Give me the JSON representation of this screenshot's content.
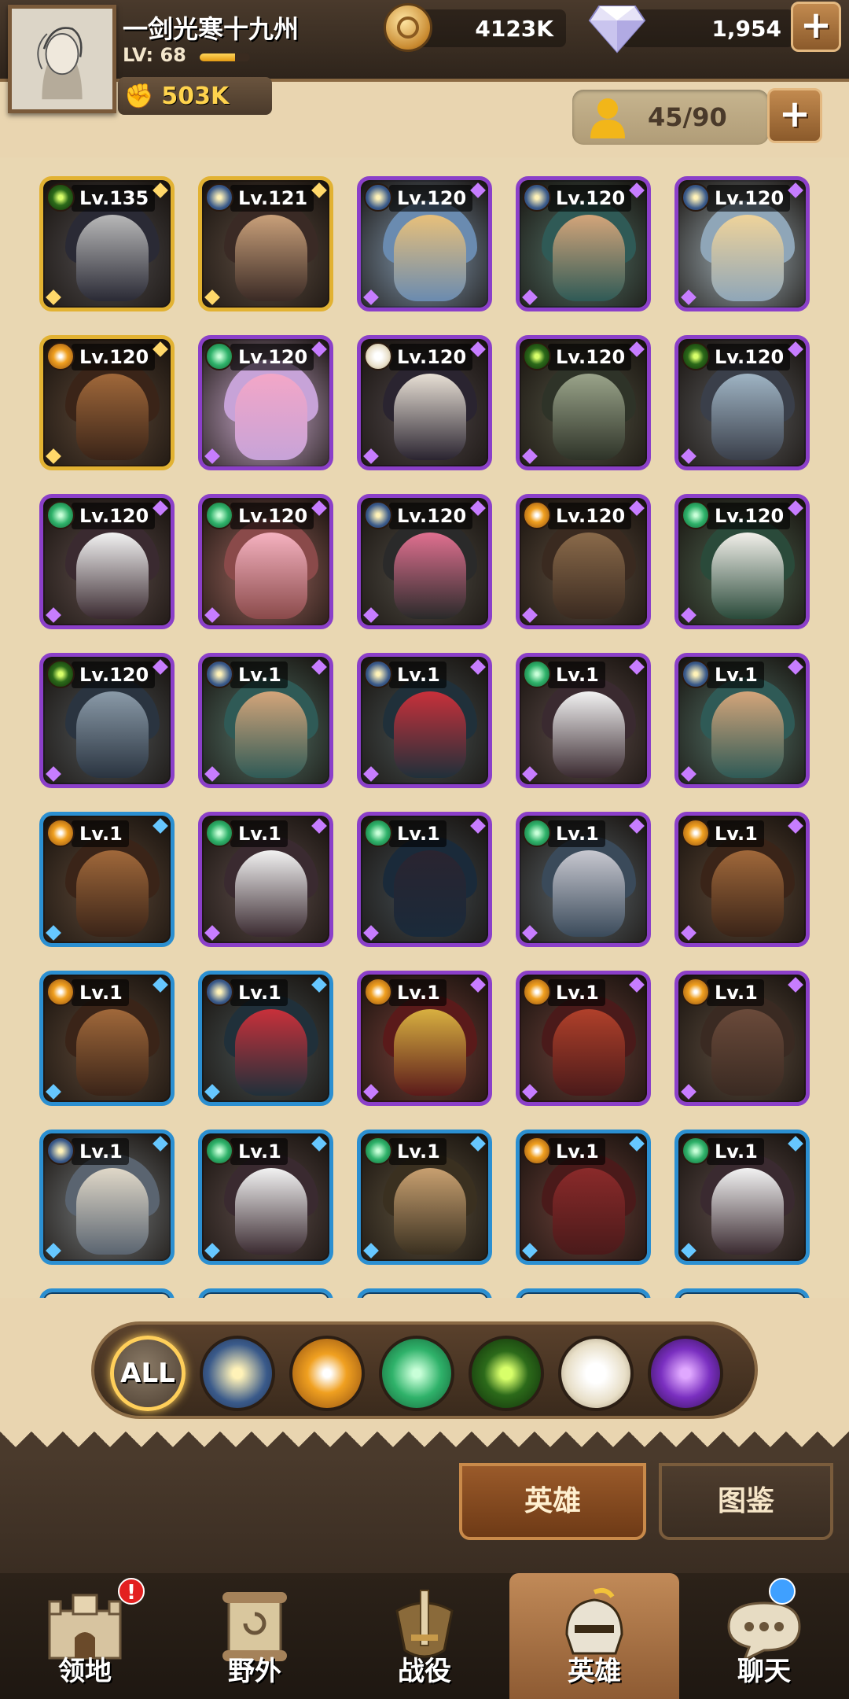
{
  "player": {
    "name": "一剑光寒十九州",
    "level_text": "LV: 68",
    "xp_fraction": 0.7,
    "power": "503K"
  },
  "resources": {
    "gold": "4123K",
    "gems": "1,954"
  },
  "hero_count": "45/90",
  "colors": {
    "purple_border": "#8b3fc9",
    "gold_border": "#e2b232",
    "blue_border": "#2b8fd1",
    "light_faction": "#f0c84a",
    "mauler_faction": "#e08a1e",
    "wilder_faction": "#2fb26a",
    "graveborn_faction": "#3f8a2c",
    "celestial_faction": "#f3efe5",
    "hypogean_faction": "#8a3fd0"
  },
  "heroes": [
    {
      "level": "Lv.135",
      "frame": "gold",
      "faction": "graveborn",
      "palette": [
        "#2a2a35",
        "#b8b8b8"
      ]
    },
    {
      "level": "Lv.121",
      "frame": "gold",
      "faction": "lightbearer",
      "palette": [
        "#3a2a25",
        "#c9a07a"
      ]
    },
    {
      "level": "Lv.120",
      "frame": "purple",
      "faction": "lightbearer",
      "palette": [
        "#6a8bb0",
        "#e8c07a"
      ]
    },
    {
      "level": "Lv.120",
      "frame": "purple",
      "faction": "lightbearer",
      "palette": [
        "#2f5a56",
        "#d4a57a"
      ]
    },
    {
      "level": "Lv.120",
      "frame": "purple",
      "faction": "lightbearer",
      "palette": [
        "#8fa6b8",
        "#efd39a"
      ]
    },
    {
      "level": "Lv.120",
      "frame": "gold",
      "faction": "mauler",
      "palette": [
        "#3a2418",
        "#a0683a"
      ]
    },
    {
      "level": "Lv.120",
      "frame": "purple",
      "faction": "wilder",
      "palette": [
        "#c7a3d8",
        "#f3a6c7"
      ]
    },
    {
      "level": "Lv.120",
      "frame": "purple",
      "faction": "celestial",
      "palette": [
        "#2a2430",
        "#e8e0d5"
      ]
    },
    {
      "level": "Lv.120",
      "frame": "purple",
      "faction": "graveborn",
      "palette": [
        "#2e3328",
        "#9aa48a"
      ]
    },
    {
      "level": "Lv.120",
      "frame": "purple",
      "faction": "graveborn",
      "palette": [
        "#3a3f4a",
        "#9fb4c4"
      ]
    },
    {
      "level": "Lv.120",
      "frame": "purple",
      "faction": "wilder",
      "palette": [
        "#3a2a30",
        "#f2f2f2"
      ]
    },
    {
      "level": "Lv.120",
      "frame": "purple",
      "faction": "wilder",
      "palette": [
        "#8a4a4a",
        "#f5b2c0"
      ]
    },
    {
      "level": "Lv.120",
      "frame": "purple",
      "faction": "lightbearer",
      "palette": [
        "#2a2a2a",
        "#e07090"
      ]
    },
    {
      "level": "Lv.120",
      "frame": "purple",
      "faction": "mauler",
      "palette": [
        "#3a2a20",
        "#8a6a4a"
      ]
    },
    {
      "level": "Lv.120",
      "frame": "purple",
      "faction": "wilder",
      "palette": [
        "#2a4a3a",
        "#f2f0ea"
      ]
    },
    {
      "level": "Lv.120",
      "frame": "purple",
      "faction": "graveborn",
      "palette": [
        "#2a3440",
        "#8a9aa8"
      ]
    },
    {
      "level": "Lv.1",
      "frame": "purple",
      "faction": "lightbearer",
      "palette": [
        "#2f5a56",
        "#d4a57a"
      ]
    },
    {
      "level": "Lv.1",
      "frame": "purple",
      "faction": "lightbearer",
      "palette": [
        "#20303a",
        "#c8303a"
      ]
    },
    {
      "level": "Lv.1",
      "frame": "purple",
      "faction": "wilder",
      "palette": [
        "#3a2a30",
        "#f2f2f2"
      ]
    },
    {
      "level": "Lv.1",
      "frame": "purple",
      "faction": "lightbearer",
      "palette": [
        "#2f5a56",
        "#d4a57a"
      ]
    },
    {
      "level": "Lv.1",
      "frame": "blue",
      "faction": "mauler",
      "palette": [
        "#3a2418",
        "#a0683a"
      ]
    },
    {
      "level": "Lv.1",
      "frame": "purple",
      "faction": "wilder",
      "palette": [
        "#3a2a30",
        "#f2f2f2"
      ]
    },
    {
      "level": "Lv.1",
      "frame": "purple",
      "faction": "wilder",
      "palette": [
        "#1a2a3a",
        "#2a2430"
      ]
    },
    {
      "level": "Lv.1",
      "frame": "purple",
      "faction": "wilder",
      "palette": [
        "#3a4a5a",
        "#c8c8d0"
      ]
    },
    {
      "level": "Lv.1",
      "frame": "purple",
      "faction": "mauler",
      "palette": [
        "#3a2418",
        "#a0683a"
      ]
    },
    {
      "level": "Lv.1",
      "frame": "blue",
      "faction": "mauler",
      "palette": [
        "#3a2418",
        "#a0683a"
      ]
    },
    {
      "level": "Lv.1",
      "frame": "blue",
      "faction": "lightbearer",
      "palette": [
        "#20303a",
        "#c8303a"
      ]
    },
    {
      "level": "Lv.1",
      "frame": "purple",
      "faction": "mauler",
      "palette": [
        "#5a1a1a",
        "#d8b040"
      ]
    },
    {
      "level": "Lv.1",
      "frame": "purple",
      "faction": "mauler",
      "palette": [
        "#4a1a1a",
        "#b0402a"
      ]
    },
    {
      "level": "Lv.1",
      "frame": "purple",
      "faction": "mauler",
      "palette": [
        "#3a2a22",
        "#6a4a3a"
      ]
    },
    {
      "level": "Lv.1",
      "frame": "blue",
      "faction": "lightbearer",
      "palette": [
        "#5a6470",
        "#e0d8c8"
      ]
    },
    {
      "level": "Lv.1",
      "frame": "blue",
      "faction": "wilder",
      "palette": [
        "#3a2a30",
        "#f2f2f2"
      ]
    },
    {
      "level": "Lv.1",
      "frame": "blue",
      "faction": "wilder",
      "palette": [
        "#3a3020",
        "#c8a070"
      ]
    },
    {
      "level": "Lv.1",
      "frame": "blue",
      "faction": "mauler",
      "palette": [
        "#4a1a1a",
        "#8a2a2a"
      ]
    },
    {
      "level": "Lv.1",
      "frame": "blue",
      "faction": "wilder",
      "palette": [
        "#3a2a30",
        "#f2f2f2"
      ]
    }
  ],
  "filters": {
    "all_label": "ALL",
    "factions": [
      "lightbearer",
      "mauler",
      "wilder",
      "graveborn",
      "celestial",
      "hypogean"
    ]
  },
  "tabs": {
    "heroes": "英雄",
    "codex": "图鉴"
  },
  "nav": {
    "territory": "领地",
    "field": "野外",
    "campaign": "战役",
    "heroes": "英雄",
    "chat": "聊天",
    "territory_badge": "!"
  }
}
